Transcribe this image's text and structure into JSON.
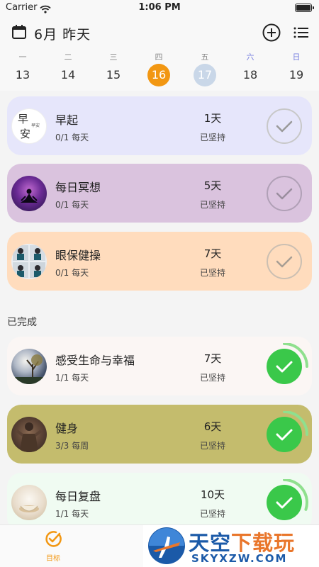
{
  "status": {
    "carrier": "Carrier",
    "time": "1:06 PM"
  },
  "header": {
    "date_label": "6月 昨天"
  },
  "week": [
    {
      "weekday": "一",
      "day": "13",
      "state": "normal"
    },
    {
      "weekday": "二",
      "day": "14",
      "state": "normal"
    },
    {
      "weekday": "三",
      "day": "15",
      "state": "normal"
    },
    {
      "weekday": "四",
      "day": "16",
      "state": "today"
    },
    {
      "weekday": "五",
      "day": "17",
      "state": "selected"
    },
    {
      "weekday": "六",
      "day": "18",
      "state": "weekend"
    },
    {
      "weekday": "日",
      "day": "19",
      "state": "weekend"
    }
  ],
  "habits_pending": [
    {
      "name": "早起",
      "progress": "0/1 每天",
      "days": "1天",
      "streak_label": "已坚持",
      "color": "#e6e6fb",
      "avatar_text_large_1": "早",
      "avatar_text_large_2": "安",
      "avatar_text_small": "早安",
      "done": false
    },
    {
      "name": "每日冥想",
      "progress": "0/1 每天",
      "days": "5天",
      "streak_label": "已坚持",
      "color": "#dac3de",
      "done": false
    },
    {
      "name": "眼保健操",
      "progress": "0/1 每天",
      "days": "7天",
      "streak_label": "已坚持",
      "color": "#ffdcbd",
      "done": false
    }
  ],
  "completed_label": "已完成",
  "habits_done": [
    {
      "name": "感受生命与幸福",
      "progress": "1/1 每天",
      "days": "7天",
      "streak_label": "已坚持",
      "color": "#fbf6f4",
      "done": true,
      "ring_fraction": 0.25
    },
    {
      "name": "健身",
      "progress": "3/3 每周",
      "days": "6天",
      "streak_label": "已坚持",
      "color": "#c4bc6d",
      "done": true,
      "ring_fraction": 0.25
    },
    {
      "name": "每日复盘",
      "progress": "1/1 每天",
      "days": "10天",
      "streak_label": "已坚持",
      "color": "#f0fbf2",
      "done": true,
      "ring_fraction": 0.3
    }
  ],
  "tabbar": {
    "goal_label": "目标"
  },
  "watermark": {
    "title_a": "天空",
    "title_b": "下载玩",
    "sub": "SKYXZW.COM"
  },
  "colors": {
    "accent": "#f29712",
    "check_done": "#3ac84a",
    "check_ring": "#8fe08e",
    "check_pending": "#c8c8c8"
  }
}
